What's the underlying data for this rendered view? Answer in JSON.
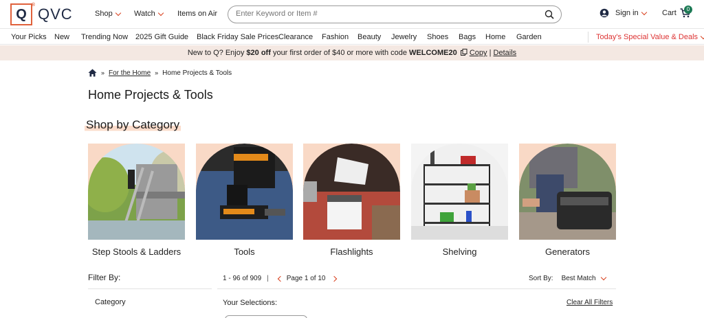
{
  "header": {
    "logo_letter": "Q",
    "logo_text": "QVC",
    "nav": [
      {
        "label": "Shop",
        "has_caret": true
      },
      {
        "label": "Watch",
        "has_caret": true
      },
      {
        "label": "Items on Air",
        "has_caret": false
      }
    ],
    "search_placeholder": "Enter Keyword or Item #",
    "signin_label": "Sign in",
    "cart_label": "Cart",
    "cart_count": "0"
  },
  "category_nav": {
    "items": [
      "Your Picks",
      "New",
      "Trending Now",
      "2025 Gift Guide",
      "Black Friday Sale Prices",
      "Clearance",
      "Fashion",
      "Beauty",
      "Jewelry",
      "Shoes",
      "Bags",
      "Home",
      "Garden"
    ],
    "special_label": "Today's Special Value & Deals"
  },
  "promo": {
    "text1": "New to Q? Enjoy ",
    "bold_amount": "$20 off",
    "text2": " your first order of $40 or more  with code ",
    "code": "WELCOME20",
    "copy_label": "Copy",
    "sep": " | ",
    "details_label": "Details"
  },
  "breadcrumb": {
    "sep": "»",
    "parent": "For the Home",
    "current": "Home Projects & Tools"
  },
  "page_title": "Home Projects & Tools",
  "section_title": "Shop by Category",
  "categories": [
    {
      "label": "Step Stools & Ladders",
      "icon": "ladder-photo"
    },
    {
      "label": "Tools",
      "icon": "drill-photo"
    },
    {
      "label": "Flashlights",
      "icon": "lantern-photo"
    },
    {
      "label": "Shelving",
      "icon": "shelf-photo"
    },
    {
      "label": "Generators",
      "icon": "generator-photo"
    }
  ],
  "filters": {
    "title": "Filter By:",
    "category_label": "Category"
  },
  "results": {
    "range": "1 - 96 of 909",
    "bar": "|",
    "page_label": "Page 1 of 10",
    "sort_label": "Sort By:",
    "sort_value": "Best Match",
    "your_selections": "Your Selections:",
    "clear_all": "Clear All Filters"
  },
  "colors": {
    "accent": "#e0613b",
    "brand_navy": "#1f2a44",
    "tile_bg": "#f9d9c6",
    "promo_bg": "#f4e8e2",
    "cart_badge": "#1c7a55"
  }
}
